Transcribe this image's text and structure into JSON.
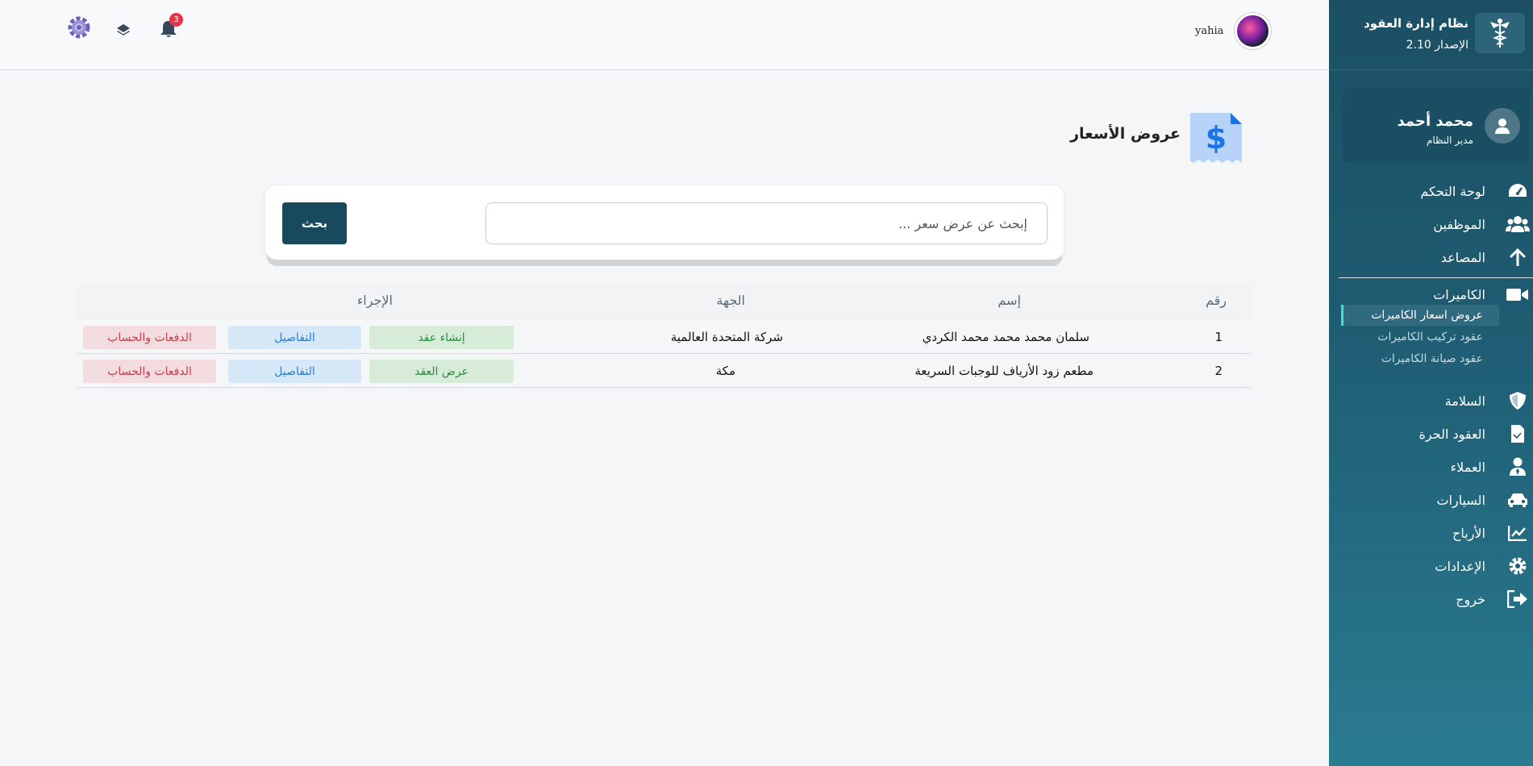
{
  "sidebar": {
    "brand_title": "نظام إدارة العقود",
    "brand_version": "الإصدار 2.10",
    "profile": {
      "name": "محمد أحمد",
      "role": "مدير النظام"
    },
    "items": [
      {
        "label": "لوحة التحكم",
        "icon": "dashboard-icon"
      },
      {
        "label": "الموظفين",
        "icon": "users-icon"
      },
      {
        "label": "المصاعد",
        "icon": "arrow-up-icon"
      },
      {
        "label": "الكاميرات",
        "icon": "video-camera-icon"
      },
      {
        "label": "السلامة",
        "icon": "shield-icon"
      },
      {
        "label": "العقود الحرة",
        "icon": "document-icon"
      },
      {
        "label": "العملاء",
        "icon": "user-tie-icon"
      },
      {
        "label": "السيارات",
        "icon": "car-icon"
      },
      {
        "label": "الأرباح",
        "icon": "chart-line-icon"
      },
      {
        "label": "الإعدادات",
        "icon": "gear-icon"
      },
      {
        "label": "خروج",
        "icon": "sign-out-icon"
      }
    ],
    "camera_subitems": [
      {
        "label": "عروض اسعار الكاميرات",
        "active": true
      },
      {
        "label": "عقود تركيب الكاميرات",
        "active": false
      },
      {
        "label": "عقود صيانة الكاميرات",
        "active": false
      }
    ]
  },
  "topbar": {
    "user_name": "yahia",
    "notification_count": "3"
  },
  "page": {
    "title": "عروض الأسعار"
  },
  "search": {
    "placeholder": "إبحث عن عرض سعر ...",
    "button_label": "بحث"
  },
  "table": {
    "headers": {
      "number": "رقم",
      "name": "إسم",
      "entity": "الجهة",
      "action": "الإجراء"
    },
    "rows": [
      {
        "number": "1",
        "name": "سلمان محمد محمد محمد الكردي",
        "entity": "شركة المتحدة العالمية",
        "action_primary": "إنشاء عقد",
        "action_details": "التفاصيل",
        "action_payments": "الدفعات والحساب"
      },
      {
        "number": "2",
        "name": "مطعم زود الأرياف للوجبات السريعة",
        "entity": "مكة",
        "action_primary": "عرض العقد",
        "action_details": "التفاصيل",
        "action_payments": "الدفعات والحساب"
      }
    ]
  },
  "colors": {
    "sidebar": "#1e5b71",
    "primary_button": "#174a5c",
    "accent_active": "#3fe2c8",
    "badge": "#e5344a"
  }
}
